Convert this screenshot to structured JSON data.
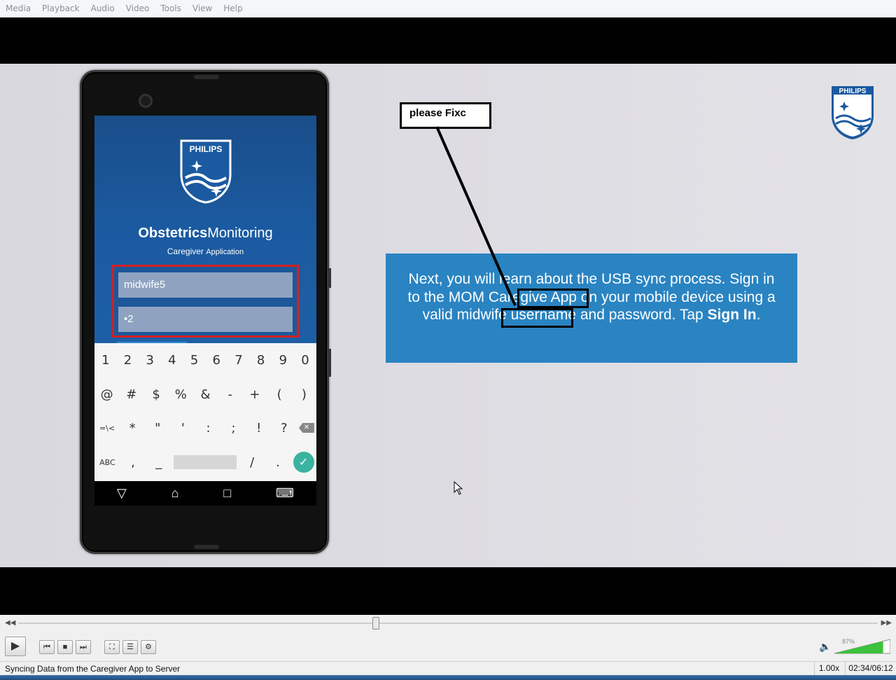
{
  "menu": [
    "Media",
    "Playback",
    "Audio",
    "Video",
    "Tools",
    "View",
    "Help"
  ],
  "phone_app": {
    "logo_text": "PHILIPS",
    "title_bold": "Obstetrics",
    "title_regular": "Monitoring",
    "subtitle_a": "Caregiver",
    "subtitle_b": "Application",
    "username": "midwife5",
    "password": "•2"
  },
  "keyboard": {
    "row1": [
      "1",
      "2",
      "3",
      "4",
      "5",
      "6",
      "7",
      "8",
      "9",
      "0"
    ],
    "row2": [
      "@",
      "#",
      "$",
      "%",
      "&",
      "-",
      "+",
      "(",
      ")"
    ],
    "row3": [
      "=\\<",
      "*",
      "\"",
      "'",
      ":",
      ";",
      "!",
      "?"
    ],
    "row4_abc": "ABC",
    "row4_comma": ",",
    "row4_underscore": "_",
    "row4_slash": "/",
    "row4_period": ".",
    "done_icon": "✓",
    "delete_icon": "✕"
  },
  "navbar": {
    "back": "▽",
    "home": "⌂",
    "recents": "□",
    "keyboard": "⌨"
  },
  "slide": {
    "corner_logo_text": "PHILIPS",
    "note": "please Fixc",
    "info_text": "Next, you will learn about the USB sync process. Sign in to the MOM Caregive App on your mobile device using a valid midwife username and password. Tap ",
    "info_bold": "Sign In",
    "info_end": "."
  },
  "player": {
    "play_icon": "▶",
    "prev_icon": "⏮",
    "stop_icon": "■",
    "next_icon": "⏭",
    "fullscreen_icon": "⛶",
    "playlist_icon": "☰",
    "extended_icon": "⚙",
    "seek_back": "◀◀",
    "seek_fwd": "▶▶",
    "volume_icon": "🔈",
    "volume": "87%",
    "volume_level": 0.87,
    "position_fraction": 0.416,
    "status": "Syncing Data from the Caregiver App to Server",
    "rate": "1.00x",
    "time": "02:34/06:12"
  }
}
